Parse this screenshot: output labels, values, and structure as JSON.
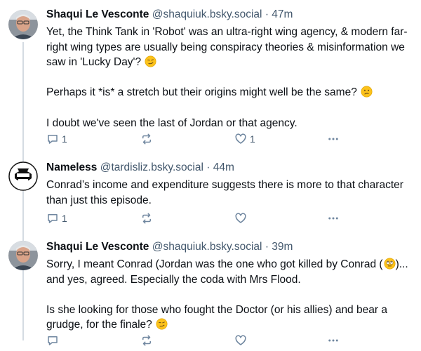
{
  "posts": [
    {
      "author": "Shaqui Le Vesconte",
      "handle": "@shaquiuk.bsky.social",
      "separator": "·",
      "time": "47m",
      "paragraphs": [
        "Yet, the Think Tank in 'Robot' was an ultra-right wing agency, & modern far-right wing types are usually being conspiracy theories & misinformation we saw in 'Lucky Day'?",
        "Perhaps it *is* a stretch but their origins might well be the same?",
        "I doubt we've seen the last of Jordan or that agency."
      ],
      "reply_count": "1",
      "repost_count": "",
      "like_count": "1"
    },
    {
      "author": "Nameless",
      "handle": "@tardisliz.bsky.social",
      "separator": "·",
      "time": "44m",
      "paragraphs": [
        "Conrad’s income and expenditure suggests there is more to that character than just this episode."
      ],
      "reply_count": "1",
      "repost_count": "",
      "like_count": ""
    },
    {
      "author": "Shaqui Le Vesconte",
      "handle": "@shaquiuk.bsky.social",
      "separator": "·",
      "time": "39m",
      "paragraphs": [
        "Sorry, I meant Conrad (Jordan was the one who got killed by Conrad",
        "Is she looking for those who fought the Doctor (or his allies) and bear a grudge, for the finale?"
      ],
      "para1_tail": "... and yes, agreed. Especially the coda with Mrs Flood.",
      "reply_count": "",
      "repost_count": "",
      "like_count": ""
    }
  ],
  "icons": {
    "reply": "reply-icon",
    "repost": "repost-icon",
    "like": "like-icon",
    "more": "more-icon"
  },
  "colors": {
    "text": "#0b0f14",
    "secondary": "#42576c",
    "icon": "#6f869f",
    "thread_line": "#d4dbe2"
  }
}
